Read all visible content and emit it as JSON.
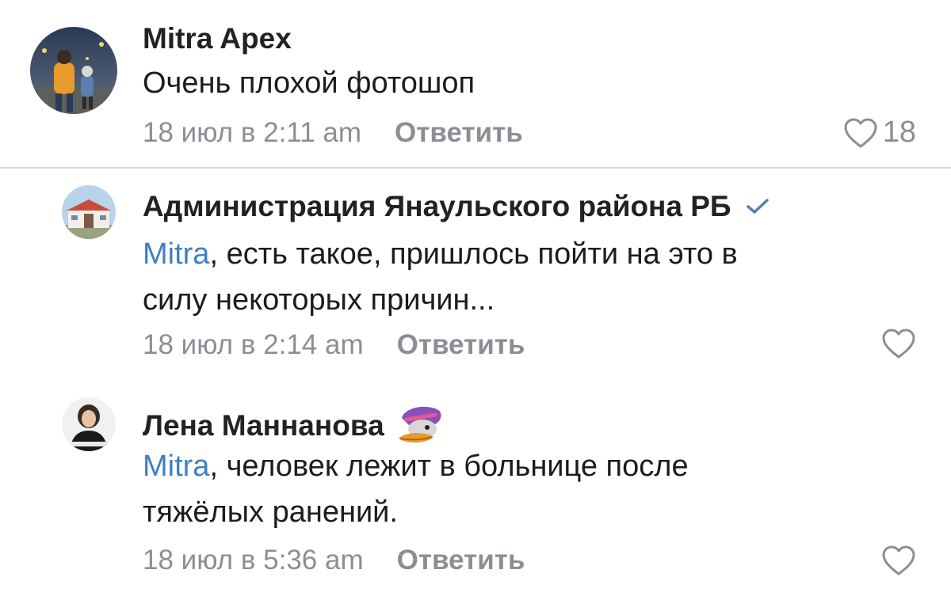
{
  "comments": [
    {
      "author": "Mitra Apex",
      "text": "Очень плохой фотошоп",
      "mention": "",
      "date": "18 июл в 2:11 am",
      "reply_label": "Ответить",
      "likes": "18",
      "verified": false
    },
    {
      "author": "Администрация Янаульского района РБ",
      "mention": "Mitra",
      "text_line1": ", есть такое, пришлось пойти на это в",
      "text_line2": "силу некоторых причин...",
      "date": "18 июл в 2:14 am",
      "reply_label": "Ответить",
      "likes": "",
      "verified": true
    },
    {
      "author": "Лена Маннанова",
      "mention": "Mitra",
      "text_line1": ", человек лежит в больнице после",
      "text_line2": "тяжёлых ранений.",
      "date": "18 июл в 5:36 am",
      "reply_label": "Ответить",
      "likes": "",
      "verified": false
    }
  ],
  "colors": {
    "mention": "#3f7fc6",
    "meta": "#8b8f94",
    "verified": "#5181b8",
    "divider": "#d6d8db"
  },
  "icons": {
    "like": "heart-outline-icon",
    "verified": "checkmark-icon",
    "sticker": "duck-sticker"
  }
}
